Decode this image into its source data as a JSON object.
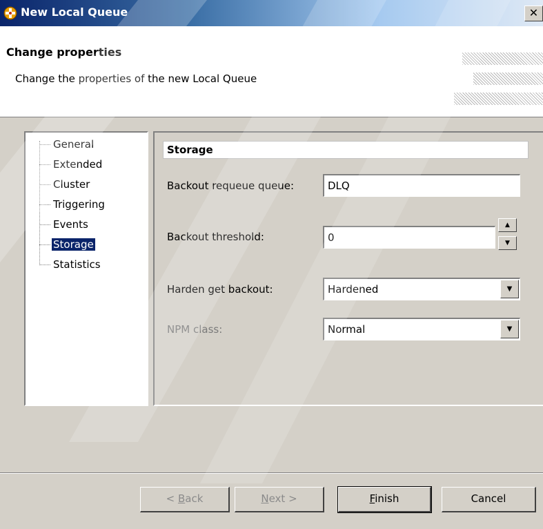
{
  "window": {
    "title": "New Local Queue",
    "close_symbol": "✕",
    "icon": "queue-app-icon"
  },
  "banner": {
    "title": "Change properties",
    "description": "Change the properties of the new Local Queue"
  },
  "tree": {
    "items": [
      {
        "label": "General",
        "selected": false
      },
      {
        "label": "Extended",
        "selected": false
      },
      {
        "label": "Cluster",
        "selected": false
      },
      {
        "label": "Triggering",
        "selected": false
      },
      {
        "label": "Events",
        "selected": false
      },
      {
        "label": "Storage",
        "selected": true
      },
      {
        "label": "Statistics",
        "selected": false
      }
    ]
  },
  "pane": {
    "section_title": "Storage",
    "fields": {
      "backout_requeue_queue": {
        "label": "Backout requeue queue:",
        "value": "DLQ"
      },
      "backout_threshold": {
        "label": "Backout threshold:",
        "value": "0"
      },
      "harden_get_backout": {
        "label": "Harden get backout:",
        "value": "Hardened"
      },
      "npm_class": {
        "label": "NPM class:",
        "value": "Normal",
        "disabled": true
      }
    }
  },
  "buttons": {
    "back": {
      "prefix": "< ",
      "mnemonic": "B",
      "rest": "ack",
      "enabled": false
    },
    "next": {
      "prefix": "",
      "mnemonic": "N",
      "rest": "ext >",
      "enabled": false
    },
    "finish": {
      "prefix": "",
      "mnemonic": "F",
      "rest": "inish",
      "enabled": true
    },
    "cancel": {
      "label": "Cancel",
      "enabled": true
    }
  },
  "colors": {
    "titlebar_start": "#0a246a",
    "dialog_face": "#d4d0c8",
    "selection": "#0a246a"
  }
}
